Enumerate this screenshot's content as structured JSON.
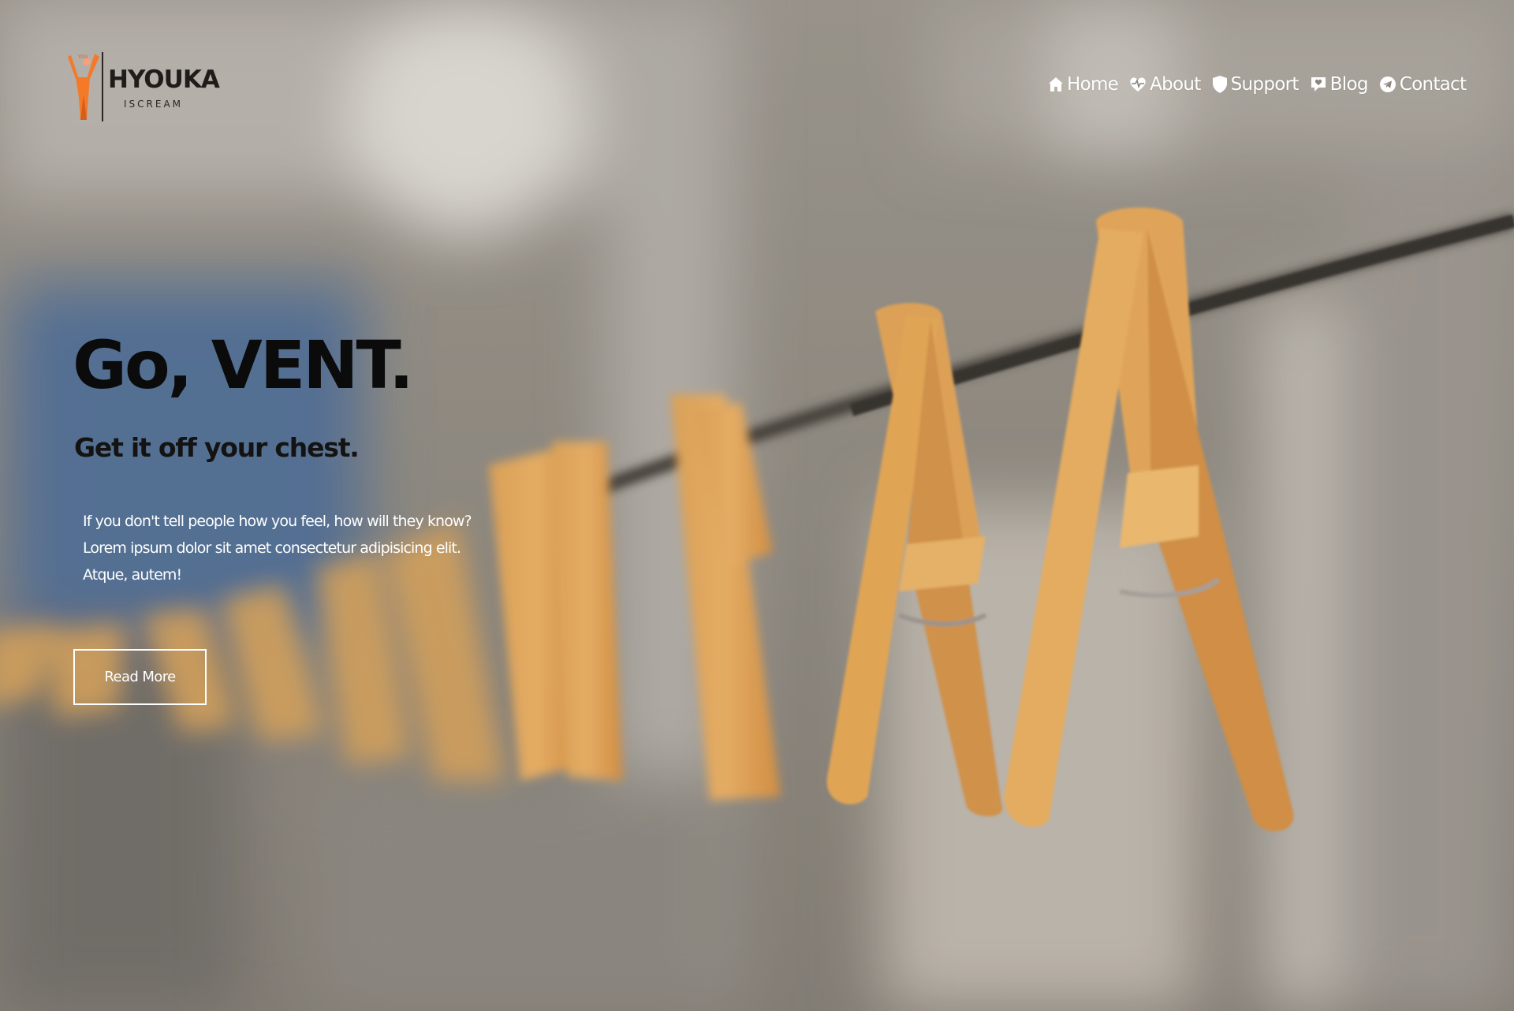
{
  "brand": {
    "name": "HYOUKA",
    "subtitle": "ISCREAM",
    "logo_icon": "person-arms-raised-icon",
    "accent_color": "#f47a2a"
  },
  "nav": {
    "items": [
      {
        "label": "Home",
        "icon": "home-icon"
      },
      {
        "label": "About",
        "icon": "heart-pulse-icon"
      },
      {
        "label": "Support",
        "icon": "shield-icon"
      },
      {
        "label": "Blog",
        "icon": "chat-heart-icon"
      },
      {
        "label": "Contact",
        "icon": "telegram-icon"
      }
    ]
  },
  "hero": {
    "title": "Go, VENT.",
    "subtitle": "Get it off your chest.",
    "body_lines": [
      "If you don't tell people how you feel, how will they know?",
      "Lorem ipsum dolor sit amet consectetur adipisicing elit.",
      "Atque, autem!"
    ],
    "cta_label": "Read More",
    "background": "blurred-photo-of-orange-clothespins-on-rope"
  },
  "colors": {
    "nav_text": "#ffffff",
    "title_text": "#0c0b0b",
    "body_text": "#ffffff",
    "clothespin": "#e9a24a"
  }
}
